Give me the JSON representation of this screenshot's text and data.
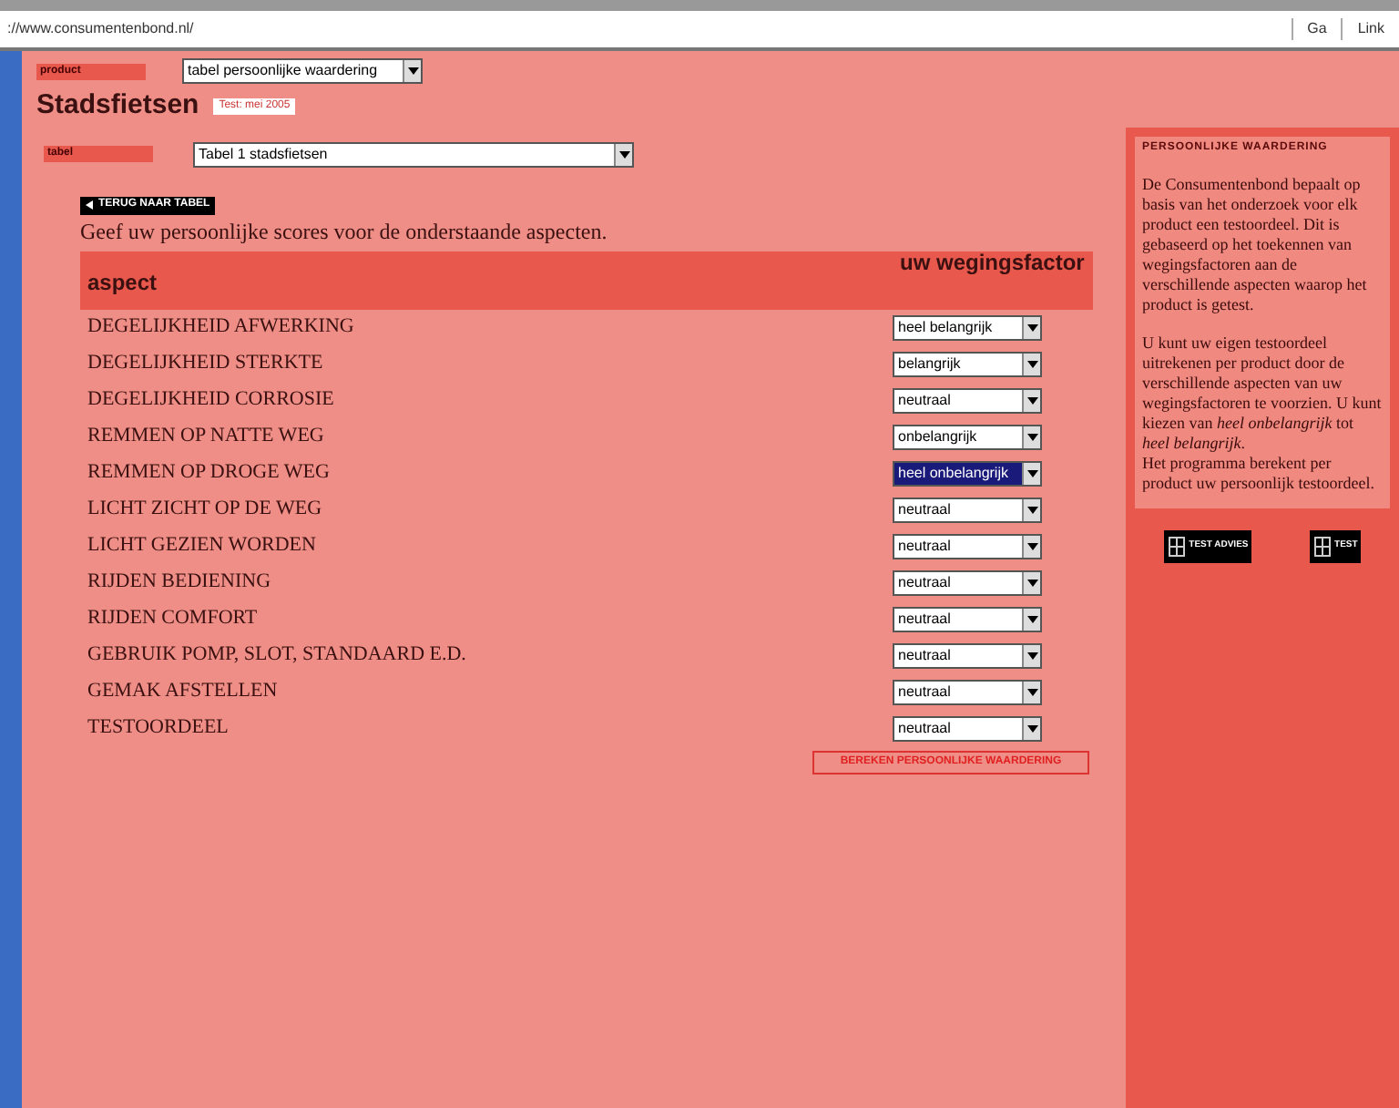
{
  "address_bar": {
    "url": "://www.consumentenbond.nl/",
    "go_label": "Ga",
    "links_label": "Link"
  },
  "product_label": "product",
  "product_select": "tabel persoonlijke waardering",
  "page_title": "Stadsfietsen",
  "test_badge": "Test: mei 2005",
  "table_label": "tabel",
  "table_select": "Tabel 1  stadsfietsen",
  "back_button": "TERUG NAAR TABEL",
  "intro": "Geef uw persoonlijke scores voor de onderstaande aspecten.",
  "columns": [
    "aspect",
    "uw wegingsfactor"
  ],
  "rows": [
    {
      "aspect": "DEGELIJKHEID AFWERKING",
      "factor": "heel belangrijk",
      "selected": false
    },
    {
      "aspect": "DEGELIJKHEID STERKTE",
      "factor": "belangrijk",
      "selected": false
    },
    {
      "aspect": "DEGELIJKHEID CORROSIE",
      "factor": "neutraal",
      "selected": false
    },
    {
      "aspect": "REMMEN OP NATTE WEG",
      "factor": "onbelangrijk",
      "selected": false
    },
    {
      "aspect": "REMMEN OP DROGE WEG",
      "factor": "heel onbelangrijk",
      "selected": true
    },
    {
      "aspect": "LICHT ZICHT OP DE WEG",
      "factor": "neutraal",
      "selected": false
    },
    {
      "aspect": "LICHT GEZIEN WORDEN",
      "factor": "neutraal",
      "selected": false
    },
    {
      "aspect": "RIJDEN BEDIENING",
      "factor": "neutraal",
      "selected": false
    },
    {
      "aspect": "RIJDEN COMFORT",
      "factor": "neutraal",
      "selected": false
    },
    {
      "aspect": "GEBRUIK POMP, SLOT, STANDAARD E.D.",
      "factor": "neutraal",
      "selected": false
    },
    {
      "aspect": "GEMAK AFSTELLEN",
      "factor": "neutraal",
      "selected": false
    },
    {
      "aspect": "TESTOORDEEL",
      "factor": "neutraal",
      "selected": false
    }
  ],
  "calc_button": "BEREKEN PERSOONLIJKE WAARDERING",
  "sidebar": {
    "title": "PERSOONLIJKE WAARDERING",
    "paragraphs": [
      "De Consumentenbond bepaalt op basis van het onderzoek voor elk product een testoordeel. Dit is gebaseerd op het toekennen van wegingsfactoren aan de verschillende aspecten waarop het product is getest.",
      "U kunt uw eigen testoordeel uitrekenen per product door de verschillende aspecten van uw wegingsfactoren te voorzien. U kunt kiezen van *heel onbelangrijk* tot *heel belangrijk*.\nHet programma berekent per product uw persoonlijk testoordeel."
    ],
    "logos": [
      "TEST ADVIES",
      "TEST"
    ]
  }
}
